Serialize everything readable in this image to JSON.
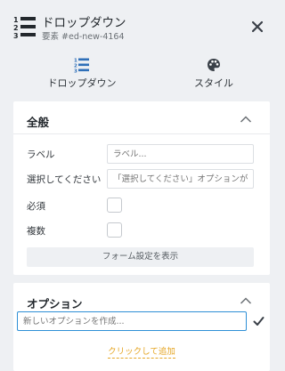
{
  "header": {
    "title": "ドロップダウン",
    "subtitle": "要素 #ed-new-4164",
    "icon": "ordered-list-icon",
    "close_icon": "close-icon"
  },
  "tabs": [
    {
      "label": "ドロップダウン",
      "icon": "ordered-list-icon",
      "active": true
    },
    {
      "label": "スタイル",
      "icon": "palette-icon",
      "active": false
    }
  ],
  "general": {
    "title": "全般",
    "label_field": {
      "label": "ラベル",
      "placeholder": "ラベル..."
    },
    "select_field": {
      "label": "選択してください",
      "placeholder": "「選択してください」オプションがない"
    },
    "required": {
      "label": "必須",
      "checked": false
    },
    "multiple": {
      "label": "複数",
      "checked": false
    },
    "form_settings_button": "フォーム設定を表示"
  },
  "options": {
    "title": "オプション",
    "new_option_placeholder": "新しいオプションを作成...",
    "add_link": "クリックして追加"
  },
  "colors": {
    "accent_blue": "#2e8fd6",
    "link_orange": "#e5a625",
    "background": "#eef0f3",
    "icon_blue": "#2e6fb8"
  }
}
